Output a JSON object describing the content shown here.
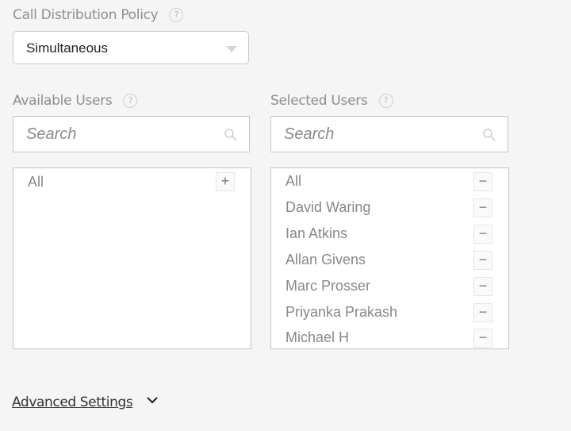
{
  "policy": {
    "label": "Call Distribution Policy",
    "help_icon": "question-circle-icon",
    "help_glyph": "?",
    "selected": "Simultaneous"
  },
  "available": {
    "label": "Available Users",
    "help_glyph": "?",
    "search_placeholder": "Search",
    "items": [
      {
        "name": "All",
        "action": "+"
      }
    ]
  },
  "selected": {
    "label": "Selected Users",
    "help_glyph": "?",
    "search_placeholder": "Search",
    "items": [
      {
        "name": "All",
        "action": "−"
      },
      {
        "name": "David Waring",
        "action": "−"
      },
      {
        "name": "Ian Atkins",
        "action": "−"
      },
      {
        "name": "Allan Givens",
        "action": "−"
      },
      {
        "name": "Marc Prosser",
        "action": "−"
      },
      {
        "name": "Priyanka Prakash",
        "action": "−"
      },
      {
        "name": "Michael H",
        "action": "−"
      }
    ]
  },
  "advanced": {
    "label": "Advanced Settings",
    "icon": "chevron-down-icon"
  }
}
